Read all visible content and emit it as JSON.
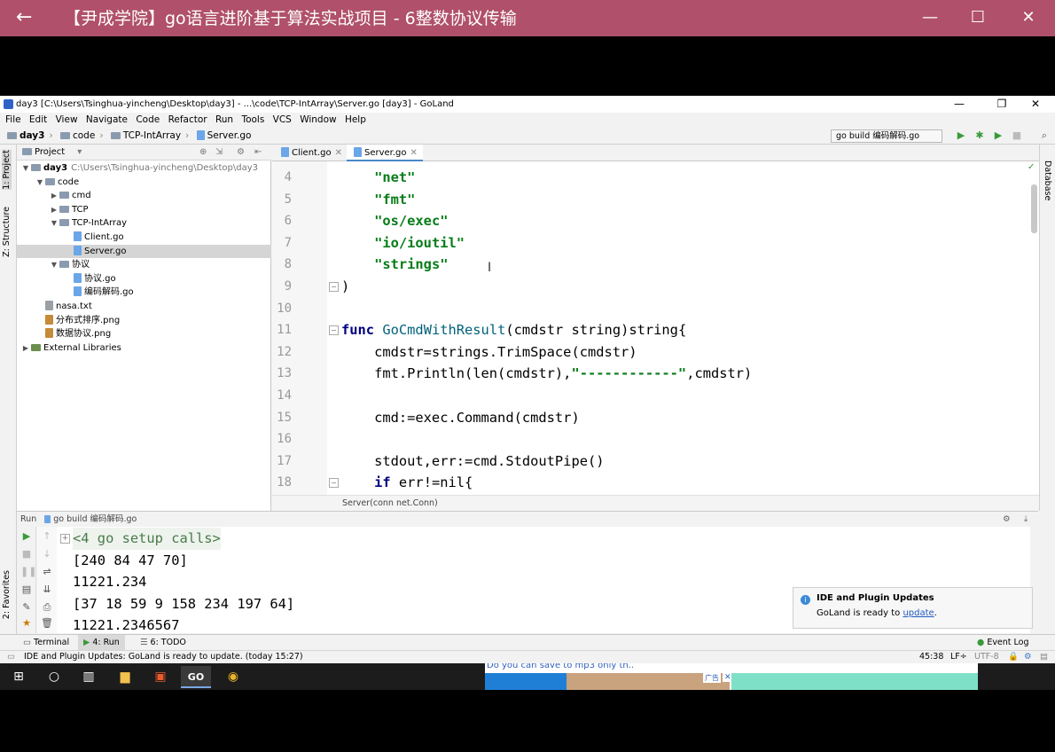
{
  "player": {
    "back_icon": "←",
    "title": "【尹成学院】go语言进阶基于算法实战项目 - 6整数协议传输",
    "minimize": "—",
    "maximize": "☐",
    "close": "✕"
  },
  "ide": {
    "window_title": "day3 [C:\\Users\\Tsinghua-yincheng\\Desktop\\day3] - ...\\code\\TCP-IntArray\\Server.go [day3] - GoLand",
    "menu": [
      "File",
      "Edit",
      "View",
      "Navigate",
      "Code",
      "Refactor",
      "Run",
      "Tools",
      "VCS",
      "Window",
      "Help"
    ],
    "breadcrumb": [
      "day3",
      "code",
      "TCP-IntArray",
      "Server.go"
    ],
    "run_config": "go build 编码解码.go",
    "left_tabs": {
      "project": "1: Project",
      "structure": "Z: Structure",
      "favorites": "2: Favorites"
    },
    "right_tabs": {
      "database": "Database"
    },
    "project": {
      "header": "Project",
      "tree": [
        {
          "label": "day3",
          "path": "C:\\Users\\Tsinghua-yincheng\\Desktop\\day3",
          "type": "folder",
          "depth": 0,
          "arrow": "▼"
        },
        {
          "label": "code",
          "type": "folder",
          "depth": 1,
          "arrow": "▼"
        },
        {
          "label": "cmd",
          "type": "folder",
          "depth": 2,
          "arrow": "▶"
        },
        {
          "label": "TCP",
          "type": "folder",
          "depth": 2,
          "arrow": "▶"
        },
        {
          "label": "TCP-IntArray",
          "type": "folder",
          "depth": 2,
          "arrow": "▼"
        },
        {
          "label": "Client.go",
          "type": "go",
          "depth": 3
        },
        {
          "label": "Server.go",
          "type": "go",
          "depth": 3,
          "selected": true
        },
        {
          "label": "协议",
          "type": "folder",
          "depth": 2,
          "arrow": "▼"
        },
        {
          "label": "协议.go",
          "type": "go",
          "depth": 3
        },
        {
          "label": "编码解码.go",
          "type": "go",
          "depth": 3
        },
        {
          "label": "nasa.txt",
          "type": "file",
          "depth": 1
        },
        {
          "label": "分布式排序.png",
          "type": "image",
          "depth": 1
        },
        {
          "label": "数据协议.png",
          "type": "image",
          "depth": 1
        },
        {
          "label": "External Libraries",
          "type": "lib",
          "depth": 0,
          "arrow": "▶"
        }
      ]
    },
    "tabs": [
      {
        "label": "Client.go"
      },
      {
        "label": "Server.go",
        "active": true
      }
    ],
    "code_lines": [
      {
        "n": "4",
        "parts": [
          [
            "    ",
            ""
          ],
          [
            "\"net\"",
            "str"
          ]
        ]
      },
      {
        "n": "5",
        "parts": [
          [
            "    ",
            ""
          ],
          [
            "\"fmt\"",
            "str"
          ]
        ]
      },
      {
        "n": "6",
        "parts": [
          [
            "    ",
            ""
          ],
          [
            "\"os/exec\"",
            "str"
          ]
        ]
      },
      {
        "n": "7",
        "parts": [
          [
            "    ",
            ""
          ],
          [
            "\"io/ioutil\"",
            "str"
          ]
        ]
      },
      {
        "n": "8",
        "parts": [
          [
            "    ",
            ""
          ],
          [
            "\"strings\"",
            "str"
          ]
        ]
      },
      {
        "n": "9",
        "parts": [
          [
            ")",
            ""
          ]
        ]
      },
      {
        "n": "10",
        "parts": []
      },
      {
        "n": "11",
        "parts": [
          [
            "func",
            "kw"
          ],
          [
            " ",
            ""
          ],
          [
            "GoCmdWithResult",
            "fn"
          ],
          [
            "(cmdstr string)string{",
            ""
          ]
        ]
      },
      {
        "n": "12",
        "parts": [
          [
            "    cmdstr=strings.TrimSpace(cmdstr)",
            ""
          ]
        ]
      },
      {
        "n": "13",
        "parts": [
          [
            "    fmt.Println(len(cmdstr),",
            ""
          ],
          [
            "\"------------\"",
            "str"
          ],
          [
            ",cmdstr)",
            ""
          ]
        ]
      },
      {
        "n": "14",
        "parts": []
      },
      {
        "n": "15",
        "parts": [
          [
            "    cmd:=exec.Command(cmdstr)",
            ""
          ]
        ]
      },
      {
        "n": "16",
        "parts": []
      },
      {
        "n": "17",
        "parts": [
          [
            "    stdout,err:=cmd.StdoutPipe()",
            ""
          ]
        ]
      },
      {
        "n": "18",
        "parts": [
          [
            "    ",
            ""
          ],
          [
            "if",
            "kw"
          ],
          [
            " err!=nil{",
            ""
          ]
        ]
      }
    ],
    "editor_breadcrumb": "Server(conn net.Conn)",
    "run_panel": {
      "header": "Run",
      "config": "go build 编码解码.go",
      "console": [
        "<4 go setup calls>",
        "[240 84 47 70]",
        "11221.234",
        "[37 18 59 9 158 234 197 64]",
        "11221.2346567"
      ]
    },
    "notification": {
      "title": "IDE and Plugin Updates",
      "text": "GoLand is ready to ",
      "link": "update",
      "suffix": "."
    },
    "bottom_tabs": [
      {
        "label": "Terminal"
      },
      {
        "label": "4: Run",
        "active": true
      },
      {
        "label": "6: TODO"
      }
    ],
    "event_log": "Event Log",
    "status": {
      "message": "IDE and Plugin Updates: GoLand is ready to update. (today 15:27)",
      "position": "45:38",
      "line_sep": "LF÷",
      "encoding": "UTF-8"
    }
  },
  "taskbar": {
    "apps": [
      "windows-start",
      "cortana",
      "task-view",
      "file-explorer",
      "media-player",
      "goland",
      "chrome"
    ],
    "ad_text": "Do you can save to mp3 only th..",
    "ad_badge": "广告"
  }
}
